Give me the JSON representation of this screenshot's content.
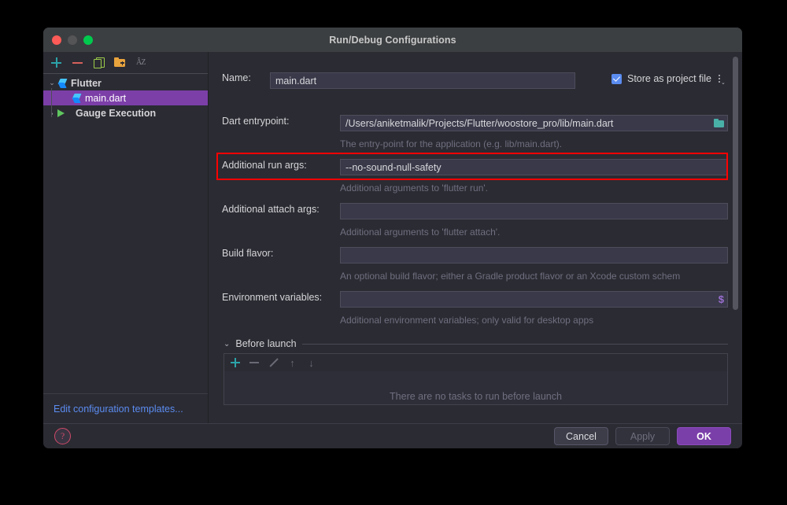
{
  "window": {
    "title": "Run/Debug Configurations",
    "traffic_lights": [
      "close",
      "minimize",
      "zoom"
    ]
  },
  "sidebar": {
    "toolbar": [
      {
        "name": "add-configuration-icon",
        "glyph": "plus"
      },
      {
        "name": "remove-configuration-icon",
        "glyph": "minus"
      },
      {
        "name": "copy-configuration-icon",
        "glyph": "copy"
      },
      {
        "name": "new-folder-icon",
        "glyph": "folder-plus"
      },
      {
        "name": "sort-configurations-icon",
        "glyph": "sort-az"
      }
    ],
    "tree": [
      {
        "label": "Flutter",
        "expanded": true,
        "selected": false,
        "icon": "flutter-logo",
        "level": 0
      },
      {
        "label": "main.dart",
        "expanded": null,
        "selected": true,
        "icon": "flutter-logo",
        "level": 1
      },
      {
        "label": "Gauge Execution",
        "expanded": false,
        "selected": false,
        "icon": "play-icon",
        "level": 0
      }
    ],
    "chevron_expanded": "⌄",
    "chevron_collapsed": "›",
    "edit_templates_link": "Edit configuration templates..."
  },
  "form": {
    "name_label": "Name:",
    "name_value": "main.dart",
    "store_as_project_file_label": "Store as project file",
    "store_as_project_file_checked": true,
    "fields": [
      {
        "label": "Dart entrypoint:",
        "value": "/Users/aniketmalik/Projects/Flutter/woostore_pro/lib/main.dart",
        "hint": "The entry-point for the application (e.g. lib/main.dart).",
        "trailing_icon": "browse-folder-icon",
        "highlighted": false
      },
      {
        "label": "Additional run args:",
        "value": "--no-sound-null-safety",
        "hint": "Additional arguments to 'flutter run'.",
        "trailing_icon": null,
        "highlighted": true
      },
      {
        "label": "Additional attach args:",
        "value": "",
        "hint": "Additional arguments to 'flutter attach'.",
        "trailing_icon": null,
        "highlighted": false
      },
      {
        "label": "Build flavor:",
        "value": "",
        "hint": "An optional build flavor; either a Gradle product flavor or an Xcode custom schem",
        "trailing_icon": null,
        "highlighted": false
      },
      {
        "label": "Environment variables:",
        "value": "",
        "hint": "Additional environment variables; only valid for desktop apps",
        "trailing_icon": "macro-dollar-icon",
        "highlighted": false
      }
    ]
  },
  "before_launch": {
    "title": "Before launch",
    "expanded": true,
    "chevron": "⌄",
    "toolbar": [
      {
        "name": "add-task-icon",
        "glyph": "plus"
      },
      {
        "name": "remove-task-icon",
        "glyph": "minus"
      },
      {
        "name": "edit-task-icon",
        "glyph": "pencil"
      },
      {
        "name": "move-task-up-icon",
        "glyph": "arrow-up"
      },
      {
        "name": "move-task-down-icon",
        "glyph": "arrow-down"
      }
    ],
    "up_glyph": "↑",
    "down_glyph": "↓",
    "empty_text": "There are no tasks to run before launch"
  },
  "footer": {
    "help_glyph": "?",
    "cancel_label": "Cancel",
    "apply_label": "Apply",
    "apply_enabled": false,
    "ok_label": "OK"
  },
  "colors": {
    "accent_primary": "#7b3fa9",
    "selection": "#7c3fa8",
    "checkbox_blue": "#5b8cf0",
    "link_blue": "#5b8cf0",
    "highlight_red": "#ff0000",
    "dialog_bg": "#2b2b33",
    "titlebar_bg": "#3c3f41"
  }
}
